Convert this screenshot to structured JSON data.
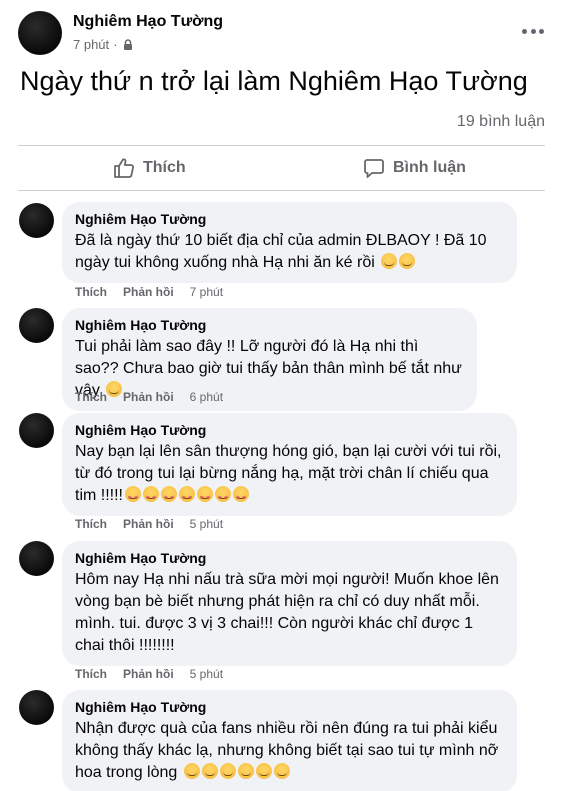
{
  "post": {
    "author": "Nghiêm Hạo Tường",
    "time": "7 phút",
    "separator": "·",
    "text": "Ngày thứ n trở lại làm Nghiêm Hạo Tường",
    "comment_count": "19 bình luận",
    "actions": {
      "like": "Thích",
      "comment": "Bình luận"
    }
  },
  "comments": [
    {
      "author": "Nghiêm Hạo Tường",
      "text": "Đã là ngày thứ 10 biết địa chỉ của admin ĐLBAOY ! Đã 10 ngày tui không xuống nhà Hạ nhi ăn ké rồi",
      "emojis": [
        "sad-face",
        "disappointed-face"
      ],
      "like": "Thích",
      "reply": "Phản hồi",
      "time": "7 phút"
    },
    {
      "author": "Nghiêm Hạo Tường",
      "text": "Tui phải làm sao đây !! Lỡ người đó là Hạ nhi thì sao?? Chưa bao giờ tui thấy bản thân mình bế tắt như vậy",
      "emojis": [
        "sad-face"
      ],
      "like": "Thích",
      "reply": "Phản hồi",
      "time": "6 phút"
    },
    {
      "author": "Nghiêm Hạo Tường",
      "text": "Nay bạn lại lên sân thượng hóng gió, bạn lại cười với tui rồi, từ đó trong tui lại bừng nắng hạ, mặt trời chân lí chiếu qua tim !!!!!",
      "emojis": [
        "smiling-face-with-hearts",
        "smiling-face-with-hearts",
        "smiling-face-with-hearts",
        "smiling-face-with-hearts",
        "smiling-face-with-hearts",
        "smiling-face-with-hearts",
        "smiling-face-with-hearts"
      ],
      "like": "Thích",
      "reply": "Phản hồi",
      "time": "5 phút"
    },
    {
      "author": "Nghiêm Hạo Tường",
      "text": "Hôm nay Hạ nhi nấu trà sữa mời mọi người! Muốn khoe lên vòng bạn bè biết nhưng phát hiện ra chỉ có duy nhất mỗi. mình. tui. được 3 vị 3 chai!!! Còn người khác chỉ được 1 chai thôi !!!!!!!!",
      "emojis": [],
      "like": "Thích",
      "reply": "Phản hồi",
      "time": "5 phút"
    },
    {
      "author": "Nghiêm Hạo Tường",
      "text": "Nhận được quà của fans nhiều rồi nên đúng ra tui phải kiểu không thấy khác lạ, nhưng không biết tại sao tui tự mình nỡ hoa trong lòng",
      "emojis": [
        "smiling-face-with-smiling-eyes",
        "smiling-face-with-smiling-eyes",
        "smiling-face-with-smiling-eyes",
        "smiling-face-with-smiling-eyes",
        "smiling-face-with-smiling-eyes",
        "smiling-face-with-smiling-eyes"
      ]
    }
  ]
}
